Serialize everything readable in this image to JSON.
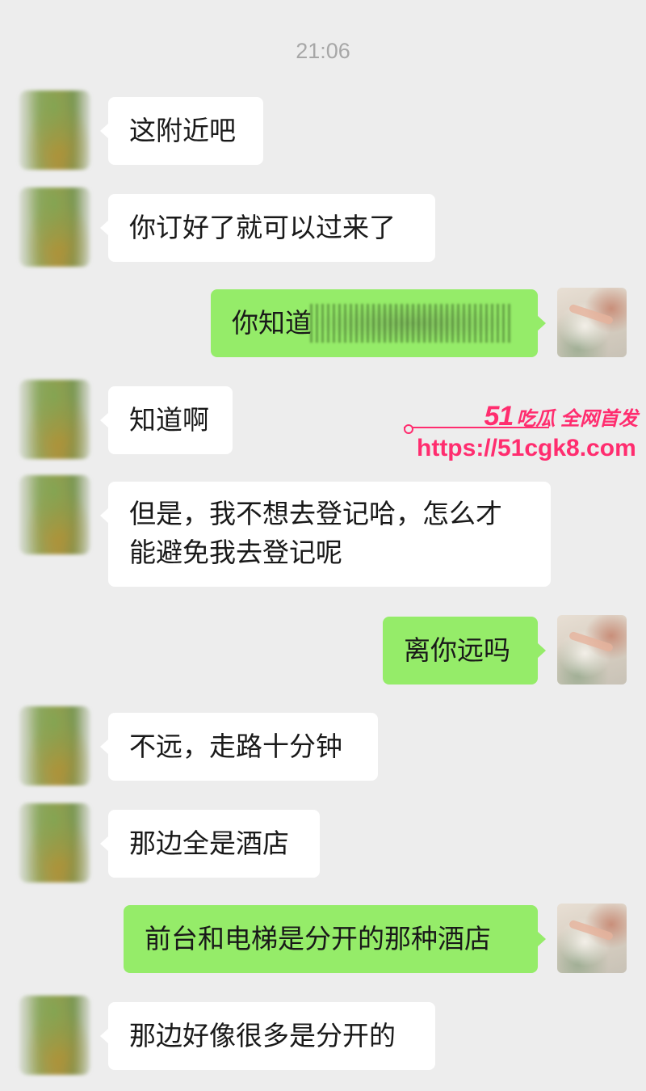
{
  "timestamp": "21:06",
  "messages": [
    {
      "side": "left",
      "text": "这附近吧"
    },
    {
      "side": "left",
      "text": "你订好了就可以过来了"
    },
    {
      "side": "right",
      "text": "你知道"
    },
    {
      "side": "left",
      "text": "知道啊"
    },
    {
      "side": "left",
      "line1": "但是，我不想去登记哈，怎么才",
      "line2": "能避免我去登记呢"
    },
    {
      "side": "right",
      "text": "离你远吗"
    },
    {
      "side": "left",
      "text": "不远，走路十分钟"
    },
    {
      "side": "left",
      "text": "那边全是酒店"
    },
    {
      "side": "right",
      "text": "前台和电梯是分开的那种酒店"
    },
    {
      "side": "left",
      "text": "那边好像很多是分开的"
    }
  ],
  "watermark": {
    "number": "51",
    "text": "吃瓜 全网首发",
    "url": "https://51cgk8.com"
  },
  "colors": {
    "background": "#ededed",
    "bubble_left": "#ffffff",
    "bubble_right": "#95ec69",
    "watermark": "#ff2d6f"
  }
}
